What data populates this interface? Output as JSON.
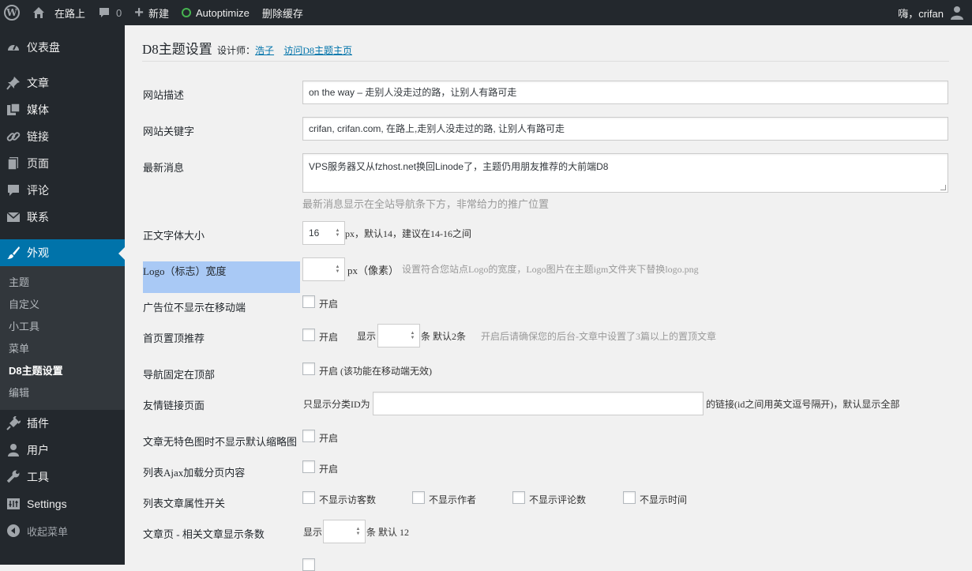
{
  "adminbar": {
    "site_name": "在路上",
    "comments_count": "0",
    "new_label": "新建",
    "autoptimize_label": "Autoptimize",
    "clear_cache_label": "删除缓存",
    "greeting": "嗨，crifan"
  },
  "sidebar": {
    "items": [
      {
        "label": "仪表盘",
        "icon": "dashboard-icon"
      },
      {
        "label": "文章",
        "icon": "pin-icon"
      },
      {
        "label": "媒体",
        "icon": "media-icon"
      },
      {
        "label": "链接",
        "icon": "link-icon"
      },
      {
        "label": "页面",
        "icon": "page-icon"
      },
      {
        "label": "评论",
        "icon": "comment-icon"
      },
      {
        "label": "联系",
        "icon": "mail-icon"
      },
      {
        "label": "外观",
        "icon": "brush-icon"
      }
    ],
    "submenu": [
      "主题",
      "自定义",
      "小工具",
      "菜单",
      "D8主题设置",
      "编辑"
    ],
    "items_after": [
      {
        "label": "插件",
        "icon": "plugin-icon"
      },
      {
        "label": "用户",
        "icon": "user-icon"
      },
      {
        "label": "工具",
        "icon": "wrench-icon"
      },
      {
        "label": "Settings",
        "icon": "settings-icon"
      },
      {
        "label": "收起菜单",
        "icon": "collapse-icon"
      }
    ]
  },
  "page": {
    "title": "D8主题设置",
    "designer_label": "设计师：",
    "designer_link": "浩子",
    "homepage_link": "访问D8主题主页"
  },
  "form": {
    "site_desc": {
      "label": "网站描述",
      "value": "on the way – 走别人没走过的路，让别人有路可走"
    },
    "site_keywords": {
      "label": "网站关键字",
      "value": "crifan, crifan.com, 在路上,走别人没走过的路, 让别人有路可走"
    },
    "latest_news": {
      "label": "最新消息",
      "value": "VPS服务器又从fzhost.net换回Linode了，主题仍用朋友推荐的大前端D8",
      "hint": "最新消息显示在全站导航条下方，非常给力的推广位置"
    },
    "font_size": {
      "label": "正文字体大小",
      "value": "16",
      "suffix": "px，默认14，建议在14-16之间"
    },
    "logo_width": {
      "label": "Logo（标志）宽度",
      "value": "",
      "suffix": "px（像素）",
      "hint": "设置符合您站点Logo的宽度，Logo图片在主题igm文件夹下替换logo.png"
    },
    "hide_ads_mobile": {
      "label": "广告位不显示在移动端",
      "option": "开启"
    },
    "home_sticky": {
      "label": "首页置顶推荐",
      "option": "开启",
      "show_label": "显示",
      "value": "",
      "count_suffix": "条 默认2条",
      "hint": "开启后请确保您的后台-文章中设置了3篇以上的置顶文章"
    },
    "nav_fixed": {
      "label": "导航固定在顶部",
      "option": "开启 (该功能在移动端无效)"
    },
    "friend_links": {
      "label": "友情链接页面",
      "prefix": "只显示分类ID为",
      "value": "",
      "suffix": "的链接(id之间用英文逗号隔开)，默认显示全部"
    },
    "no_thumb": {
      "label": "文章无特色图时不显示默认缩略图",
      "option": "开启"
    },
    "ajax_list": {
      "label": "列表Ajax加载分页内容",
      "option": "开启"
    },
    "list_attrs": {
      "label": "列表文章属性开关",
      "options": [
        "不显示访客数",
        "不显示作者",
        "不显示评论数",
        "不显示时间"
      ]
    },
    "related": {
      "label": "文章页 - 相关文章显示条数",
      "show_label": "显示",
      "value": "",
      "suffix": "条 默认 12"
    }
  }
}
